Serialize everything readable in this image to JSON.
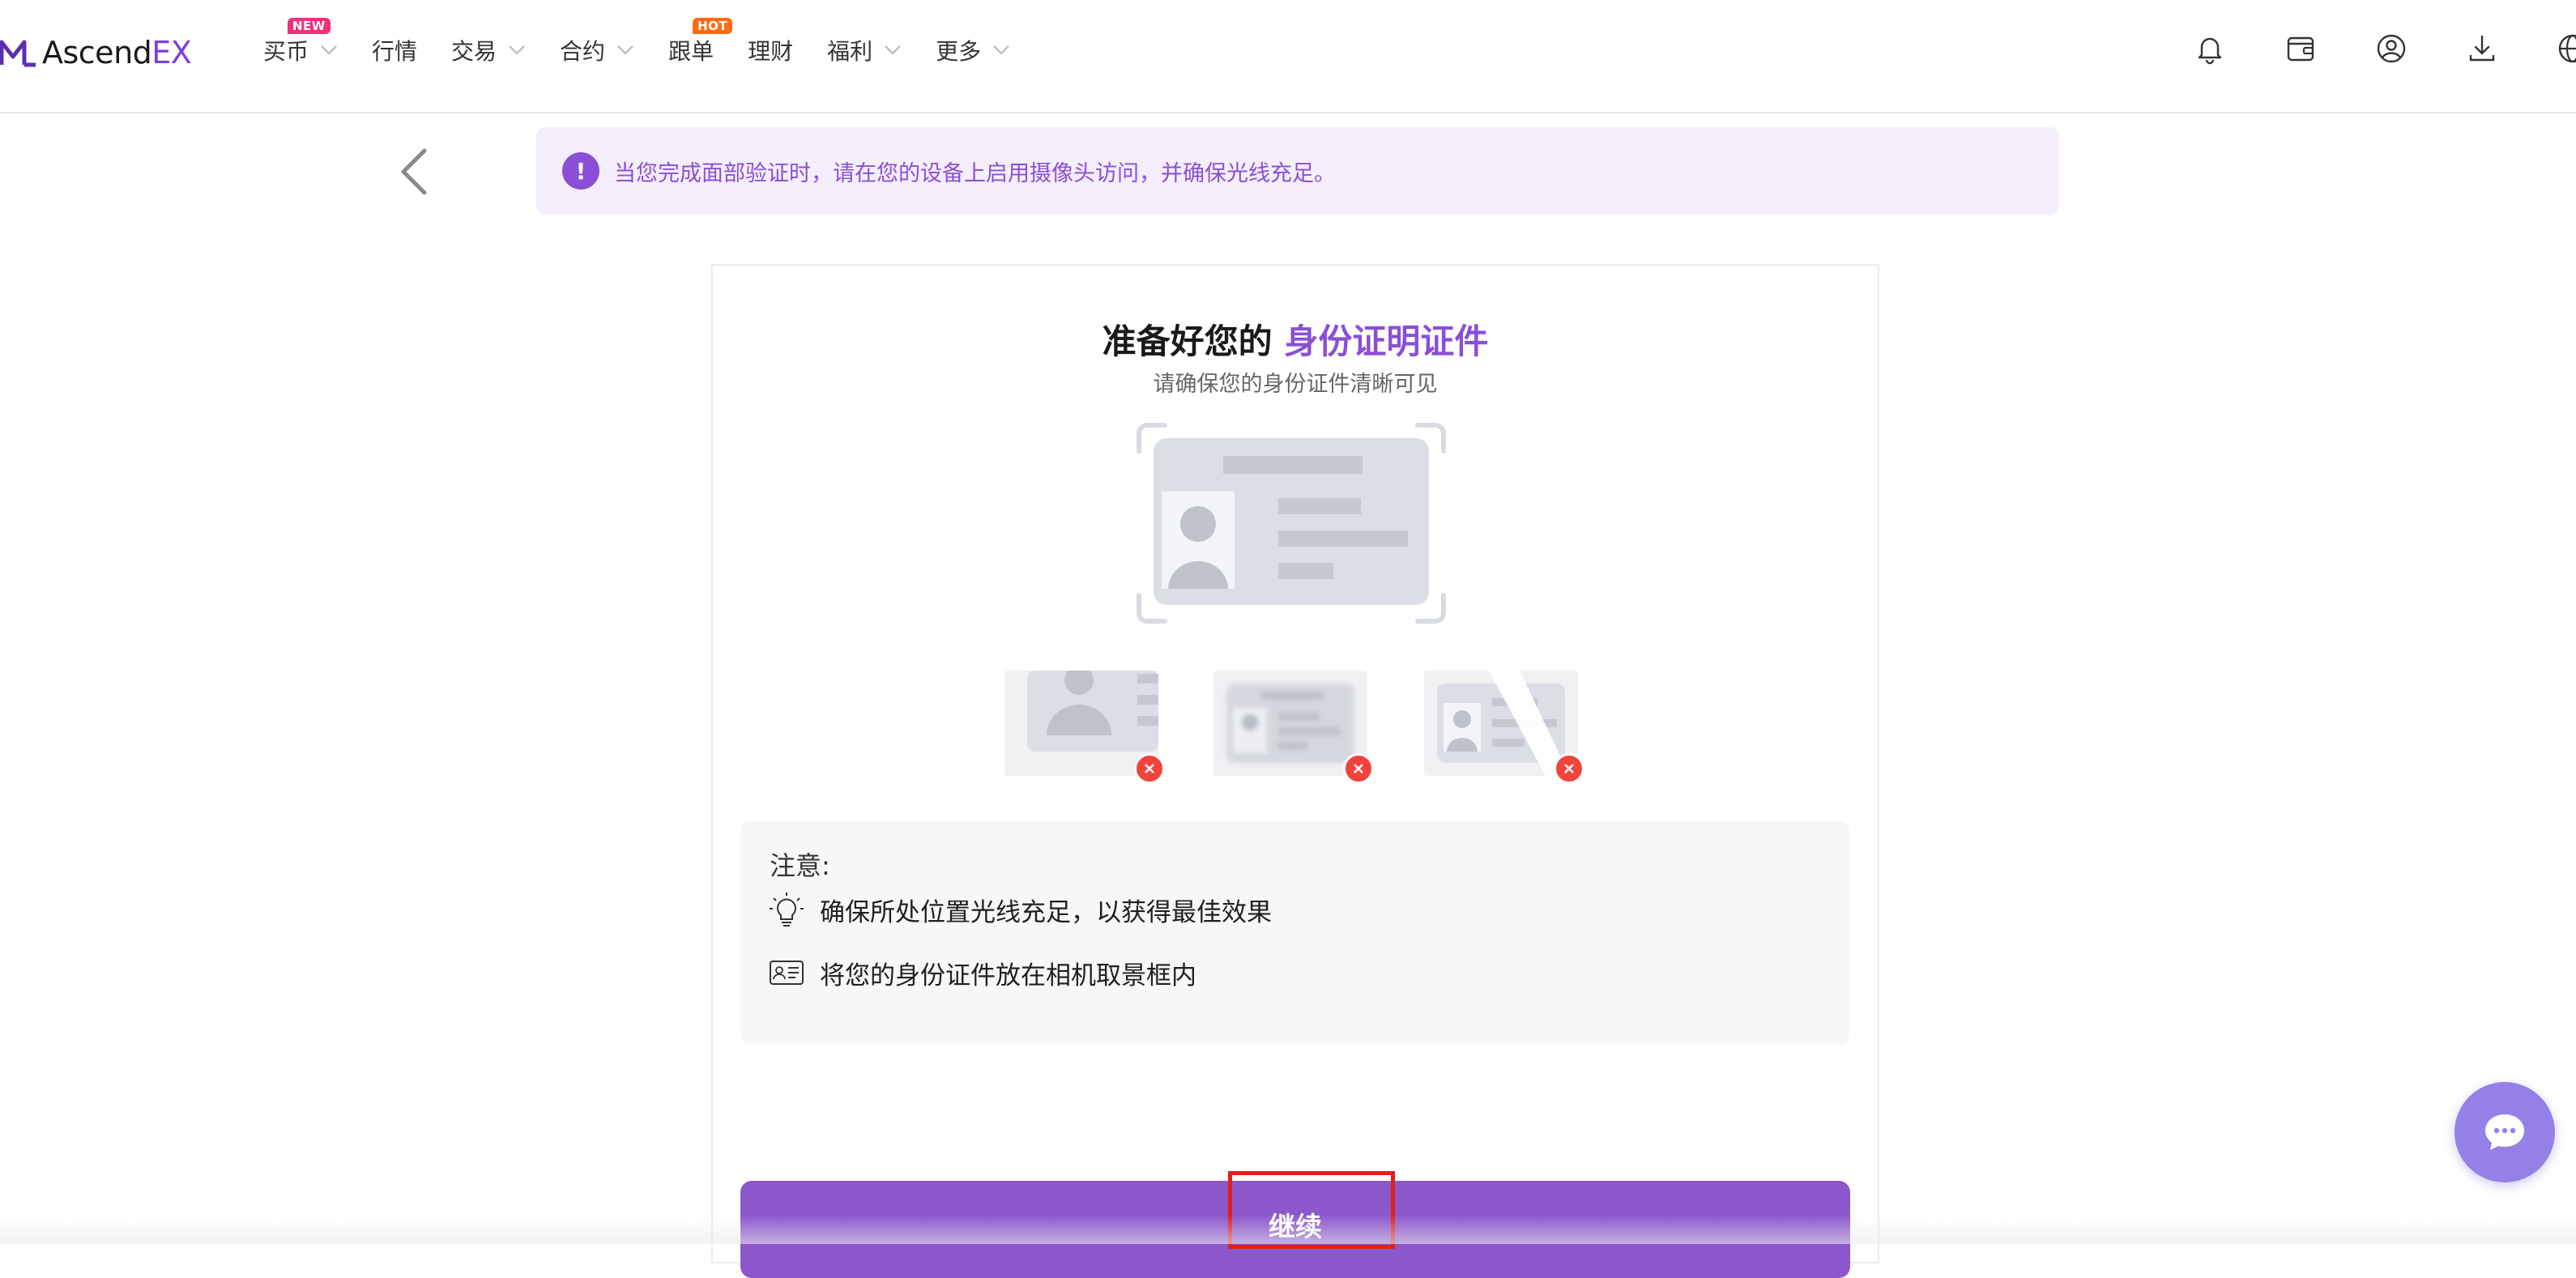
{
  "brand": {
    "name_prefix": "Ascend",
    "name_suffix": "EX",
    "accent": "#8a4fd6"
  },
  "nav": {
    "items": [
      {
        "label": "买币",
        "badge": "NEW",
        "has_dropdown": true
      },
      {
        "label": "行情",
        "has_dropdown": false
      },
      {
        "label": "交易",
        "has_dropdown": true
      },
      {
        "label": "合约",
        "has_dropdown": true
      },
      {
        "label": "跟单",
        "badge": "HOT",
        "has_dropdown": false
      },
      {
        "label": "理财",
        "has_dropdown": false
      },
      {
        "label": "福利",
        "has_dropdown": true
      },
      {
        "label": "更多",
        "has_dropdown": true
      }
    ],
    "right_icons": [
      "bell-icon",
      "wallet-icon",
      "user-icon",
      "download-icon",
      "globe-icon"
    ]
  },
  "notice": {
    "icon": "exclamation-icon",
    "text": "当您完成面部验证时，请在您的设备上启用摄像头访问，并确保光线充足。"
  },
  "card": {
    "title_prefix": "准备好您的",
    "title_highlight": "身份证明证件",
    "subtitle": "请确保您的身份证件清晰可见",
    "bad_examples": [
      "cropped-id-example",
      "blurry-id-example",
      "glare-id-example"
    ],
    "tips": {
      "heading": "注意:",
      "items": [
        {
          "icon": "lightbulb-icon",
          "text": "确保所处位置光线充足，以获得最佳效果"
        },
        {
          "icon": "id-card-icon",
          "text": "将您的身份证件放在相机取景框内"
        }
      ]
    },
    "continue_label": "继续"
  },
  "colors": {
    "cta": "#8d57cc",
    "notice_bg": "#f5eefc",
    "error": "#f0433b",
    "chat_fab": "#9580e8"
  }
}
